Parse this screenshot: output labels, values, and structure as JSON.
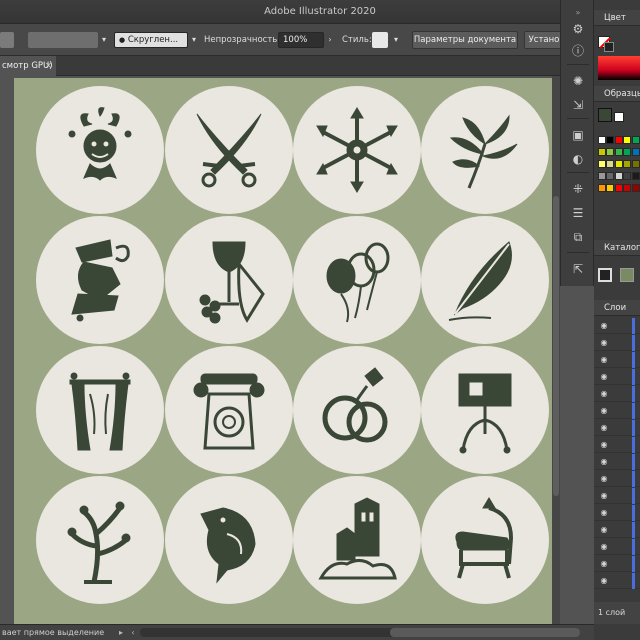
{
  "app": {
    "title": "Adobe Illustrator 2020"
  },
  "control_bar": {
    "brush_value": "Скруглен...",
    "opacity_label": "Непрозрачность:",
    "opacity_value": "100%",
    "style_label": "Стиль:",
    "doc_settings_button": "Параметры документа",
    "preferences_button": "Устано"
  },
  "document_tab": {
    "label": "смотр GPU)"
  },
  "panels": {
    "color": {
      "title": "Цвет",
      "spectrum_top": "#ff3b30"
    },
    "swatches": {
      "title": "Образцы",
      "rows": [
        [
          "#ffffff",
          "#000000",
          "#ff0000",
          "#ffff00",
          "#00a651"
        ],
        [
          "#c8c800",
          "#8dc63f",
          "#39b54a",
          "#00a651",
          "#0072bc"
        ],
        [
          "#ffff66",
          "#d9d98c",
          "#e6e600",
          "#a6a600",
          "#737300"
        ],
        [
          "#999999",
          "#666666",
          "#d4d4d4",
          "#404040",
          "#1a1a1a"
        ],
        [
          "#ff9900",
          "#ffcc00",
          "#ff0000",
          "#cc0000",
          "#990000"
        ]
      ]
    },
    "catalog": {
      "title": "Каталог"
    },
    "layers": {
      "title": "Слои",
      "count_label": "1 слой",
      "row_count": 16
    }
  },
  "status": {
    "text": "вает прямое выделение"
  },
  "artboard": {
    "background": "#9ba784",
    "circle_fill": "#eae7e0",
    "ink": "#3a4737",
    "icons": [
      "jester-mask-icon",
      "crossed-sabers-icon",
      "snowflake-ornament-icon",
      "plant-leaves-icon",
      "handshake-icon",
      "wine-grapes-icon",
      "balloons-icon",
      "feather-quill-icon",
      "theater-curtain-icon",
      "rotary-telephone-icon",
      "wedding-rings-icon",
      "signboard-easel-icon",
      "curly-tree-icon",
      "crow-bird-icon",
      "fairytale-castle-icon",
      "vintage-armchair-icon"
    ]
  }
}
